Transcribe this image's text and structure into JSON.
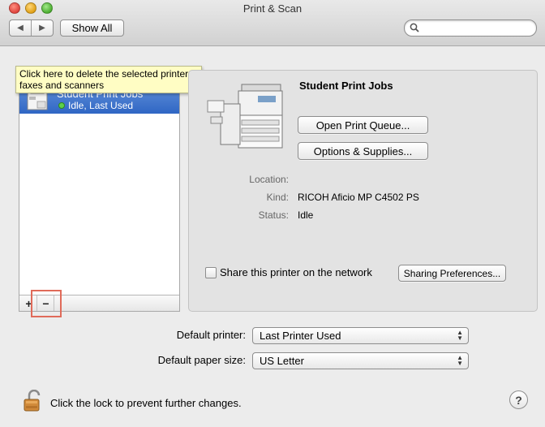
{
  "window": {
    "title": "Print & Scan"
  },
  "toolbar": {
    "back_glyph": "◀",
    "forward_glyph": "▶",
    "show_all_label": "Show All",
    "search_placeholder": ""
  },
  "printer_list": {
    "items": [
      {
        "name": "Student Print Jobs",
        "status": "Idle, Last Used",
        "status_color": "#5ed14a"
      }
    ],
    "add_label": "+",
    "remove_label": "−"
  },
  "tooltip": {
    "text": "Click here to delete the selected printers, faxes and scanners"
  },
  "detail": {
    "printer_name": "Student Print Jobs",
    "open_queue_label": "Open Print Queue...",
    "options_supplies_label": "Options & Supplies...",
    "fields": [
      {
        "label": "Location:",
        "value": ""
      },
      {
        "label": "Kind:",
        "value": "RICOH Aficio MP C4502 PS"
      },
      {
        "label": "Status:",
        "value": "Idle"
      }
    ],
    "share_label": "Share this printer on the network",
    "share_checked": false,
    "sharing_prefs_label": "Sharing Preferences..."
  },
  "defaults": {
    "printer_label": "Default printer:",
    "printer_value": "Last Printer Used",
    "paper_label": "Default paper size:",
    "paper_value": "US Letter"
  },
  "footer": {
    "lock_text": "Click the lock to prevent further changes.",
    "help_label": "?"
  },
  "colors": {
    "selection": "#3a6fcb",
    "highlight_box": "#e06b5a",
    "tooltip_bg": "#fffdc4"
  }
}
